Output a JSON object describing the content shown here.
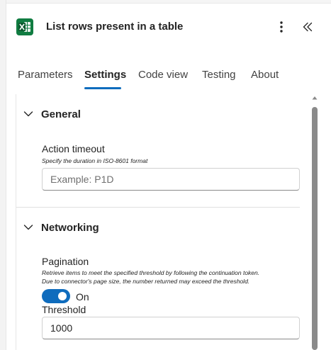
{
  "header": {
    "title": "List rows present in a table",
    "app_icon": "excel-icon",
    "more_icon": "more-vertical-icon",
    "collapse_icon": "double-chevron-left-icon"
  },
  "tabs": [
    {
      "label": "Parameters",
      "active": false
    },
    {
      "label": "Settings",
      "active": true
    },
    {
      "label": "Code view",
      "active": false
    },
    {
      "label": "Testing",
      "active": false
    },
    {
      "label": "About",
      "active": false
    }
  ],
  "general": {
    "title": "General",
    "action_timeout": {
      "label": "Action timeout",
      "help": "Specify the duration in ISO-8601 format",
      "placeholder": "Example: P1D",
      "value": ""
    }
  },
  "networking": {
    "title": "Networking",
    "pagination": {
      "label": "Pagination",
      "help_line1": "Retrieve items to meet the specified threshold by following the continuation token.",
      "help_line2": "Due to connector's page size, the number returned may exceed the threshold.",
      "toggle_state": "On",
      "enabled": true
    },
    "threshold": {
      "label": "Threshold",
      "value": "1000"
    }
  },
  "colors": {
    "accent": "#0f6cbd",
    "excel_green": "#107c41",
    "scroll_thumb": "#8a8a8a"
  }
}
